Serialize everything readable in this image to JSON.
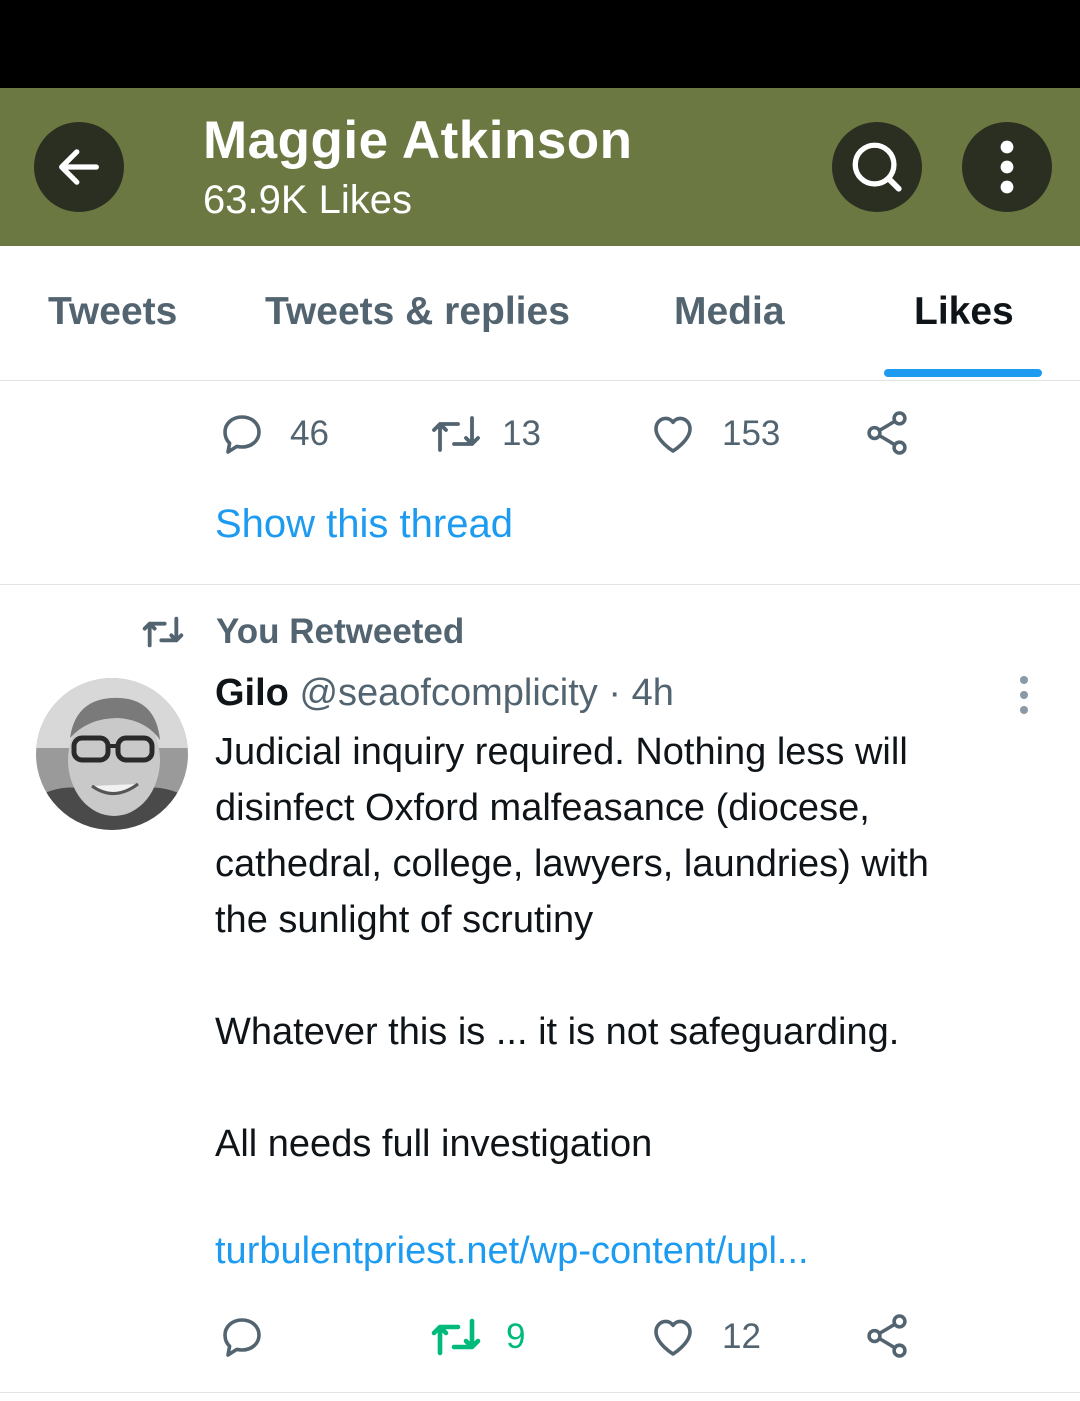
{
  "header": {
    "title": "Maggie Atkinson",
    "subtitle": "63.9K Likes",
    "header_color": "#6c7842",
    "icons": {
      "back": "arrow-left-icon",
      "search": "search-icon",
      "more": "more-vertical-icon"
    }
  },
  "tabs": [
    {
      "label": "Tweets",
      "active": false
    },
    {
      "label": "Tweets & replies",
      "active": false
    },
    {
      "label": "Media",
      "active": false
    },
    {
      "label": "Likes",
      "active": true
    }
  ],
  "accent_color": "#1d9bf0",
  "previous_tweet": {
    "actions": {
      "replies": "46",
      "retweets": "13",
      "likes": "153"
    },
    "show_thread": "Show this thread"
  },
  "tweet": {
    "context": "You Retweeted",
    "name": "Gilo",
    "handle": "@seaofcomplicity",
    "separator": "·",
    "time": "4h",
    "text_lines": [
      "Judicial inquiry required. Nothing less will",
      "disinfect Oxford malfeasance (diocese,",
      "cathedral, college, lawyers, laundries) with",
      "the sunlight of scrutiny"
    ],
    "paragraph2": "Whatever this is ... it is not safeguarding.",
    "paragraph3": "All needs full investigation",
    "link": "turbulentpriest.net/wp-content/upl...",
    "actions": {
      "replies": "",
      "retweets": "9",
      "likes": "12",
      "retweeted": true
    },
    "retweet_active_color": "#00ba7c"
  }
}
